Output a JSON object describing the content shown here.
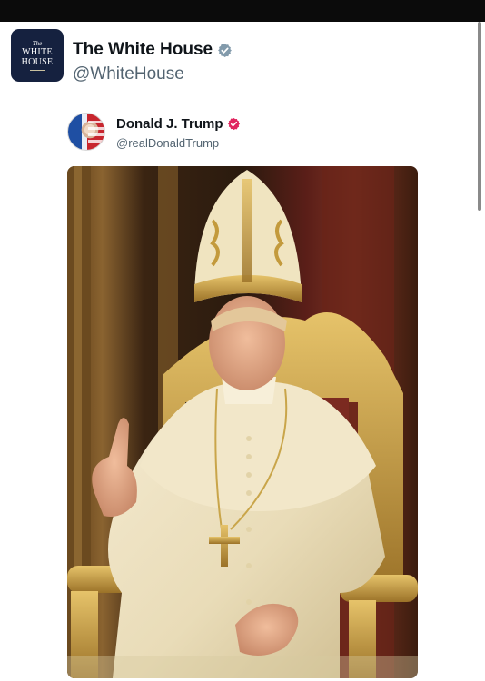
{
  "post": {
    "author": {
      "avatar_text": {
        "small": "The",
        "line1": "WHITE",
        "line2": "HOUSE"
      },
      "display_name": "The White House",
      "handle": "@WhiteHouse",
      "badge_color": "#829aab"
    },
    "quoted": {
      "display_name": "Donald J. Trump",
      "handle": "@realDonaldTrump",
      "badge_color": "#e0245e"
    },
    "media": {
      "description_icon": "photo"
    }
  }
}
